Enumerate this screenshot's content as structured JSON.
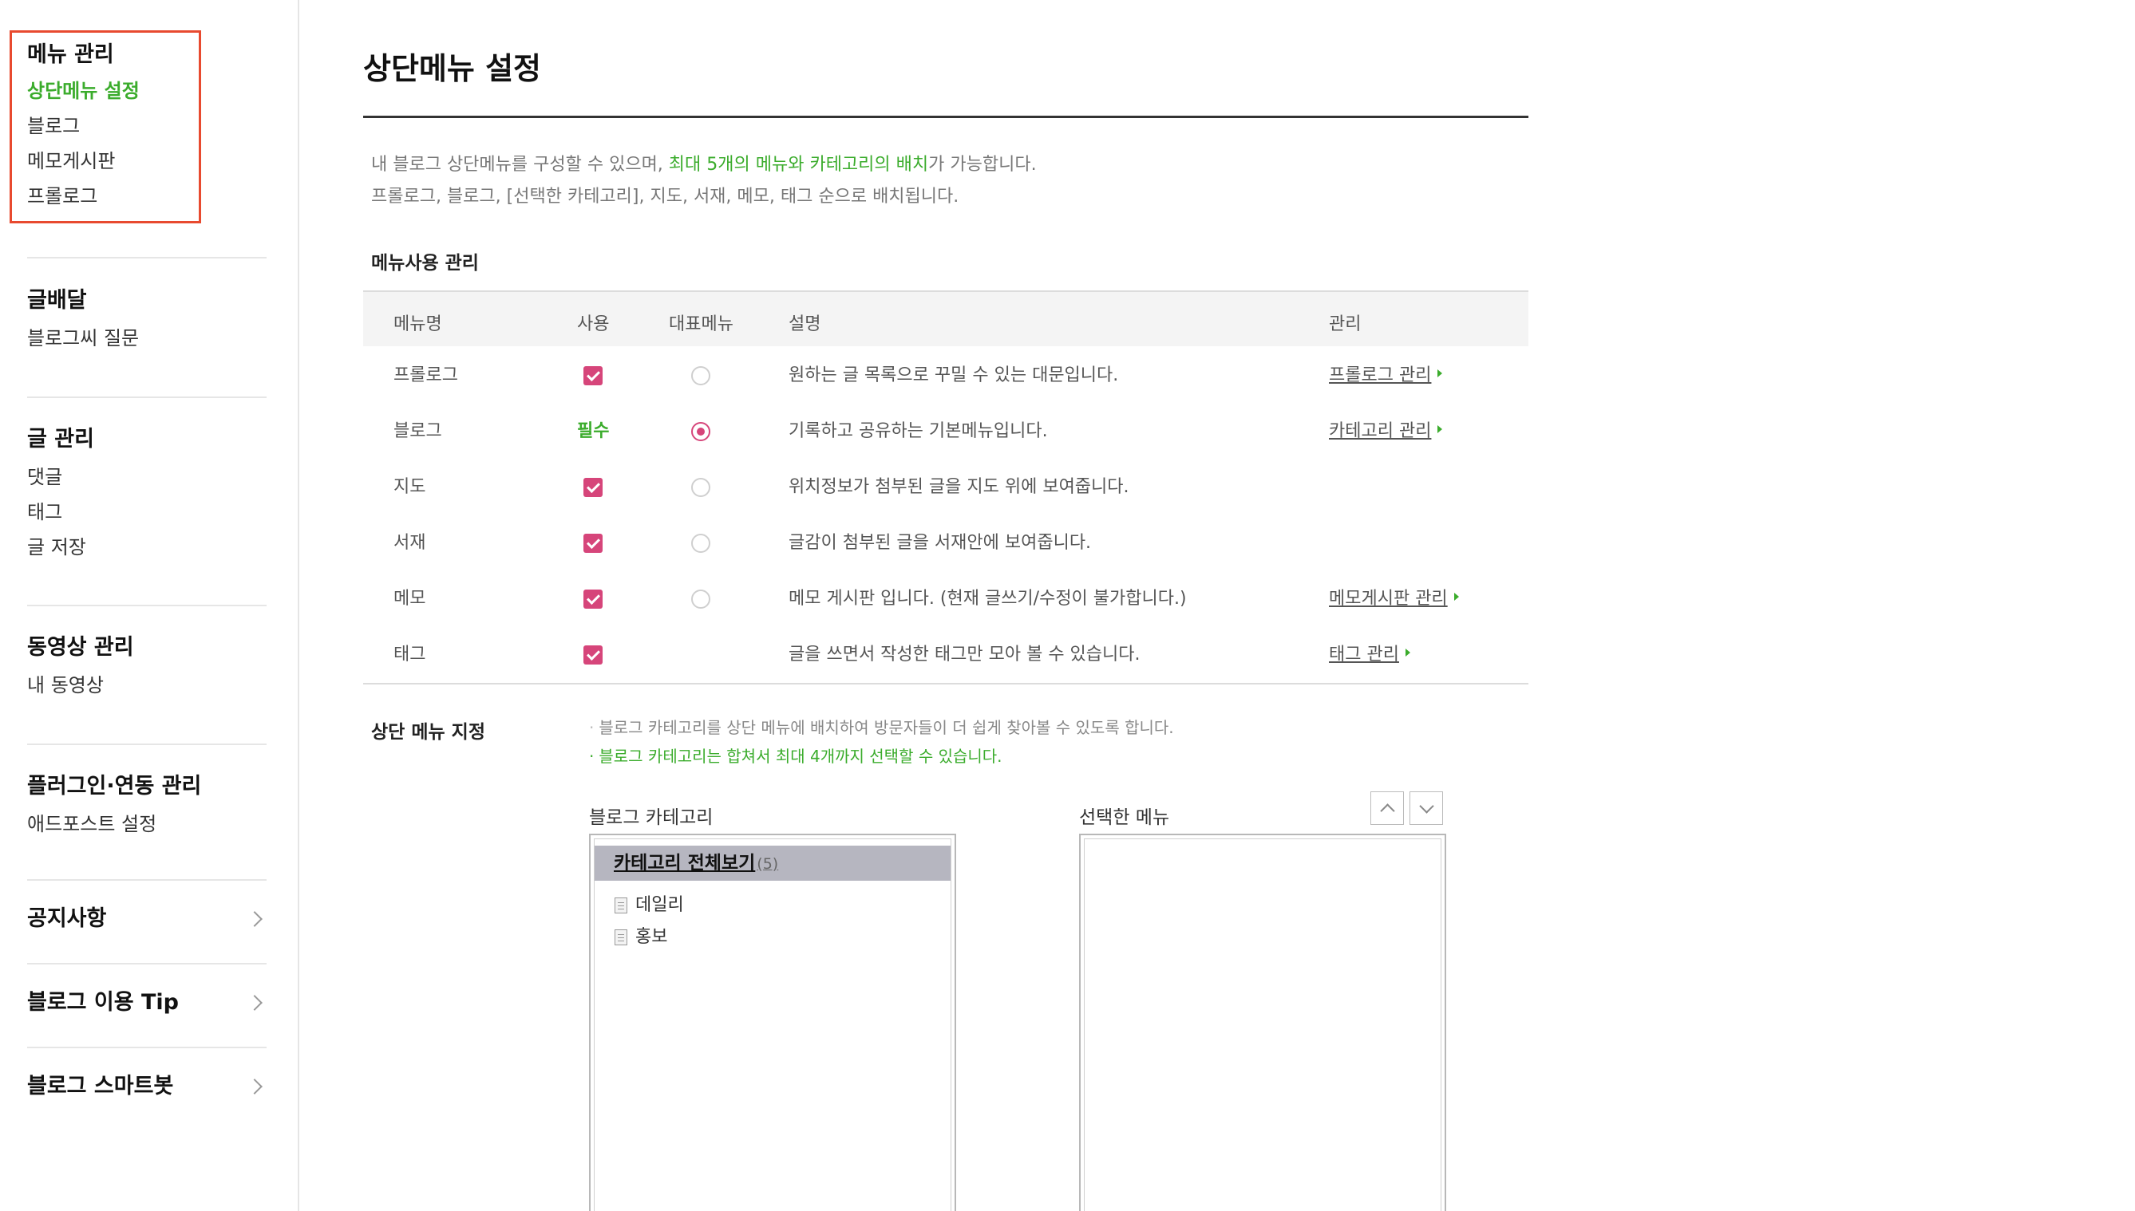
{
  "sidebar": {
    "menu_manage": {
      "title": "메뉴 관리",
      "items": [
        "상단메뉴 설정",
        "블로그",
        "메모게시판",
        "프롤로그"
      ]
    },
    "sections": [
      {
        "title": "글배달",
        "items": [
          "블로그씨 질문"
        ]
      },
      {
        "title": "글 관리",
        "items": [
          "댓글",
          "태그",
          "글 저장"
        ]
      },
      {
        "title": "동영상 관리",
        "items": [
          "내 동영상"
        ]
      },
      {
        "title": "플러그인·연동 관리",
        "items": [
          "애드포스트 설정"
        ]
      }
    ],
    "links": [
      "공지사항",
      "블로그 이용 Tip",
      "블로그 스마트봇"
    ]
  },
  "main": {
    "title": "상단메뉴 설정",
    "desc1_pre": "내 블로그 상단메뉴를 구성할 수 있으며, ",
    "desc1_hl": "최대 5개의 메뉴와 카테고리의 배치",
    "desc1_post": "가 가능합니다.",
    "desc2": "프롤로그, 블로그, [선택한 카테고리], 지도, 서재, 메모, 태그 순으로 배치됩니다.",
    "section_label": "메뉴사용 관리",
    "table": {
      "headers": [
        "메뉴명",
        "사용",
        "대표메뉴",
        "설명",
        "관리"
      ],
      "rows": [
        {
          "name": "프롤로그",
          "use": "checked",
          "rep": "off",
          "desc": "원하는 글 목록으로 꾸밀 수 있는 대문입니다.",
          "mgmt": "프롤로그 관리"
        },
        {
          "name": "블로그",
          "use": "필수",
          "rep": "on",
          "desc": "기록하고 공유하는 기본메뉴입니다.",
          "mgmt": "카테고리 관리"
        },
        {
          "name": "지도",
          "use": "checked",
          "rep": "off",
          "desc": "위치정보가 첨부된 글을 지도 위에 보여줍니다.",
          "mgmt": ""
        },
        {
          "name": "서재",
          "use": "checked",
          "rep": "off",
          "desc": "글감이 첨부된 글을 서재안에 보여줍니다.",
          "mgmt": ""
        },
        {
          "name": "메모",
          "use": "checked",
          "rep": "off",
          "desc": "메모 게시판 입니다. (현재 글쓰기/수정이 불가합니다.)",
          "mgmt": "메모게시판 관리"
        },
        {
          "name": "태그",
          "use": "checked",
          "rep": "none",
          "desc": "글을 쓰면서 작성한 태그만 모아 볼 수 있습니다.",
          "mgmt": "태그 관리"
        }
      ]
    },
    "assign": {
      "label": "상단 메뉴 지정",
      "note1": "블로그 카테고리를 상단 메뉴에 배치하여 방문자들이 더 쉽게 찾아볼 수 있도록 합니다.",
      "note2": "블로그 카테고리는 합쳐서 최대 4개까지 선택할 수 있습니다.",
      "category_label": "블로그 카테고리",
      "selected_label": "선택한 메뉴",
      "category_all": "카테고리 전체보기",
      "category_count": "(5)",
      "categories": [
        "데일리",
        "홍보"
      ]
    }
  },
  "colors": {
    "accent_green": "#3bac2c",
    "accent_pink": "#d6457a",
    "highlight_red": "#e84a2f"
  }
}
